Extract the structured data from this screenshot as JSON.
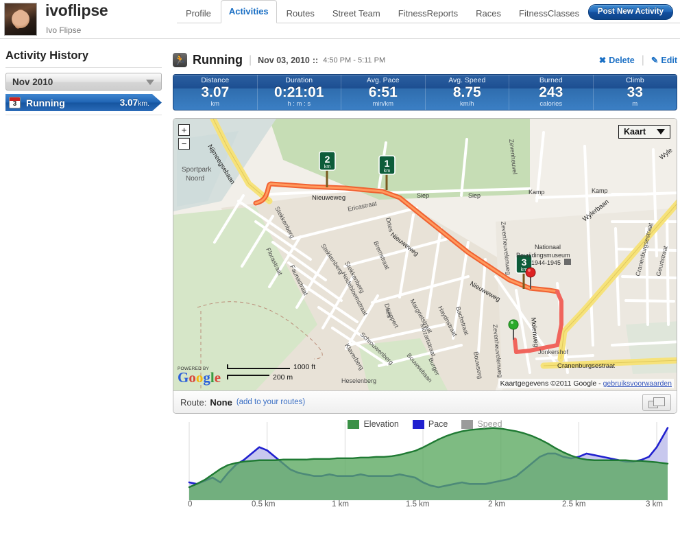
{
  "header": {
    "username": "ivoflipse",
    "realname": "Ivo Flipse",
    "avatar_alt": "user-avatar",
    "nav": [
      {
        "label": "Profile",
        "active": false
      },
      {
        "label": "Activities",
        "active": true
      },
      {
        "label": "Routes",
        "active": false
      },
      {
        "label": "Street Team",
        "active": false
      },
      {
        "label": "FitnessReports",
        "active": false
      },
      {
        "label": "Races",
        "active": false
      },
      {
        "label": "FitnessClasses",
        "active": false
      }
    ],
    "post_button": "Post New Activity"
  },
  "sidebar": {
    "title": "Activity History",
    "month_select": "Nov 2010",
    "items": [
      {
        "day": "3",
        "label": "Running",
        "distance": "3.07",
        "unit": "km."
      }
    ]
  },
  "activity": {
    "icon": "running-icon",
    "title": "Running",
    "date": "Nov 03, 2010",
    "colons": "::",
    "time_range": "4:50 PM - 5:11 PM",
    "delete_label": "Delete",
    "edit_label": "Edit",
    "divider": "|"
  },
  "stats": [
    {
      "label": "Distance",
      "value": "3.07",
      "unit": "km"
    },
    {
      "label": "Duration",
      "value": "0:21:01",
      "unit": "h : m : s"
    },
    {
      "label": "Avg. Pace",
      "value": "6:51",
      "unit": "min/km"
    },
    {
      "label": "Avg. Speed",
      "value": "8.75",
      "unit": "km/h"
    },
    {
      "label": "Burned",
      "value": "243",
      "unit": "calories"
    },
    {
      "label": "Climb",
      "value": "33",
      "unit": "m"
    }
  ],
  "map": {
    "zoom_in": "+",
    "zoom_out": "−",
    "map_type": "Kaart",
    "powered_by": "POWERED BY",
    "logo_letters": [
      "G",
      "o",
      "o",
      "g",
      "l",
      "e"
    ],
    "scale_imperial": "1000 ft",
    "scale_metric": "200 m",
    "attribution": "Kaartgegevens ©2011 Google - ",
    "attribution_link": "gebruiksvoorwaarden",
    "markers": [
      {
        "label": "1",
        "unit": "km"
      },
      {
        "label": "2",
        "unit": "km"
      },
      {
        "label": "3",
        "unit": "km"
      }
    ],
    "labels": [
      "Sportpark",
      "Noord",
      "Nijmeegsebaan",
      "Nieuweweg",
      "Stekkenberg",
      "Ericastraat",
      "Florastraat",
      "Faunastraat",
      "Heidebloemstraat",
      "Bremstraat",
      "Dries",
      "Margrietstraat",
      "Leppert",
      "Schrouwenberg",
      "Klaverberg",
      "Heselenberg",
      "Mozartstraat",
      "Bachstraat",
      "Haydnstraat",
      "Siep",
      "Kamp",
      "Zevenheuvelenweg",
      "Zevenheuvel",
      "Wylerbaan",
      "Wyle",
      "Nationaal",
      "Bevrijdingsmuseum",
      "1944-1945",
      "Molenweg",
      "Jonkershof",
      "Cranenburgsestraat",
      "Burger",
      "Bouwserg",
      "Geurtstraat"
    ]
  },
  "route_bar": {
    "label": "Route:",
    "value": "None",
    "add_link": "(add to your routes)",
    "fullscreen_icon": "fullscreen-icon"
  },
  "chart_data": {
    "type": "area",
    "title": "",
    "xlabel": "",
    "ylabel": "",
    "xlim": [
      0,
      3.07
    ],
    "legend_position": "top-center",
    "grid": true,
    "legend": [
      {
        "name": "Elevation",
        "color": "#3a9146",
        "enabled": true
      },
      {
        "name": "Pace",
        "color": "#2020cf",
        "enabled": true
      },
      {
        "name": "Speed",
        "color": "#9b9b9b",
        "enabled": false
      }
    ],
    "tick_labels": [
      "0",
      "0.5 km",
      "1 km",
      "1.5 km",
      "2 km",
      "2.5 km",
      "3 km"
    ],
    "tick_values": [
      0,
      0.5,
      1,
      1.5,
      2,
      2.5,
      3
    ],
    "x": [
      0,
      0.05,
      0.1,
      0.15,
      0.2,
      0.25,
      0.3,
      0.35,
      0.4,
      0.45,
      0.5,
      0.55,
      0.6,
      0.65,
      0.7,
      0.75,
      0.8,
      0.85,
      0.9,
      0.95,
      1.0,
      1.05,
      1.1,
      1.15,
      1.2,
      1.25,
      1.3,
      1.35,
      1.4,
      1.45,
      1.5,
      1.55,
      1.6,
      1.65,
      1.7,
      1.75,
      1.8,
      1.85,
      1.9,
      1.95,
      2.0,
      2.05,
      2.1,
      2.15,
      2.2,
      2.25,
      2.3,
      2.35,
      2.4,
      2.45,
      2.5,
      2.55,
      2.6,
      2.65,
      2.7,
      2.75,
      2.8,
      2.85,
      2.9,
      2.95,
      3.0,
      3.07
    ],
    "series": [
      {
        "name": "Elevation",
        "units": "m",
        "color": "#3a9146",
        "values": [
          3,
          8,
          14,
          22,
          30,
          36,
          39,
          41,
          42,
          43,
          43,
          43,
          44,
          44,
          44,
          44,
          45,
          45,
          45,
          46,
          46,
          46,
          47,
          47,
          48,
          48,
          49,
          51,
          54,
          57,
          62,
          68,
          74,
          79,
          83,
          86,
          88,
          89,
          90,
          91,
          90,
          88,
          86,
          83,
          79,
          74,
          68,
          61,
          55,
          50,
          46,
          44,
          43,
          43,
          43,
          43,
          43,
          42,
          42,
          41,
          40,
          38
        ]
      },
      {
        "name": "Pace",
        "units": "min/km",
        "color": "#2020cf",
        "values": [
          44,
          43,
          45,
          47,
          44,
          50,
          55,
          58,
          62,
          66,
          64,
          60,
          56,
          52,
          50,
          49,
          48,
          48,
          49,
          48,
          48,
          48,
          49,
          48,
          48,
          48,
          48,
          49,
          48,
          47,
          44,
          42,
          41,
          42,
          43,
          44,
          43,
          43,
          43,
          44,
          45,
          46,
          48,
          52,
          56,
          60,
          62,
          62,
          60,
          59,
          60,
          62,
          61,
          60,
          59,
          58,
          57,
          57,
          58,
          60,
          66,
          78
        ]
      }
    ]
  }
}
